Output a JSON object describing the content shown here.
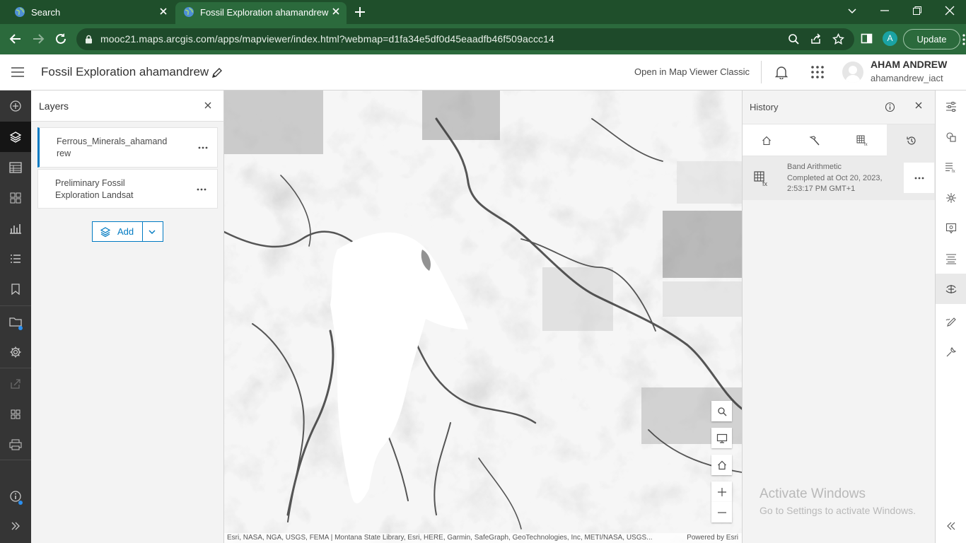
{
  "browser": {
    "tabs": [
      {
        "label": "Search"
      },
      {
        "label": "Fossil Exploration ahamandrew"
      }
    ],
    "url": "mooc21.maps.arcgis.com/apps/mapviewer/index.html?webmap=d1fa34e5df0d45eaadfb46f509accc14",
    "profile_initial": "A",
    "update_label": "Update"
  },
  "header": {
    "title": "Fossil Exploration ahamandrew",
    "open_classic": "Open in Map Viewer Classic",
    "user_name": "AHAM ANDREW",
    "user_id": "ahamandrew_iact"
  },
  "layers": {
    "title": "Layers",
    "items": [
      {
        "name": "Ferrous_Minerals_ahamandrew",
        "selected": true
      },
      {
        "name": "Preliminary Fossil Exploration Landsat",
        "selected": false
      }
    ],
    "add_label": "Add"
  },
  "map": {
    "attribution": "Esri, NASA, NGA, USGS, FEMA | Montana State Library, Esri, HERE, Garmin, SafeGraph, GeoTechnologies, Inc, METI/NASA, USGS...",
    "powered_by": "Powered by Esri"
  },
  "history": {
    "title": "History",
    "item": {
      "title": "Band Arithmetic",
      "detail": "Completed at Oct 20, 2023, 2:53:17 PM GMT+1"
    }
  },
  "watermark": {
    "line1": "Activate Windows",
    "line2": "Go to Settings to activate Windows."
  },
  "colors": {
    "browser_frame": "#1f4f2b",
    "toolbar_dark": "#353535",
    "accent": "#007ac2"
  }
}
